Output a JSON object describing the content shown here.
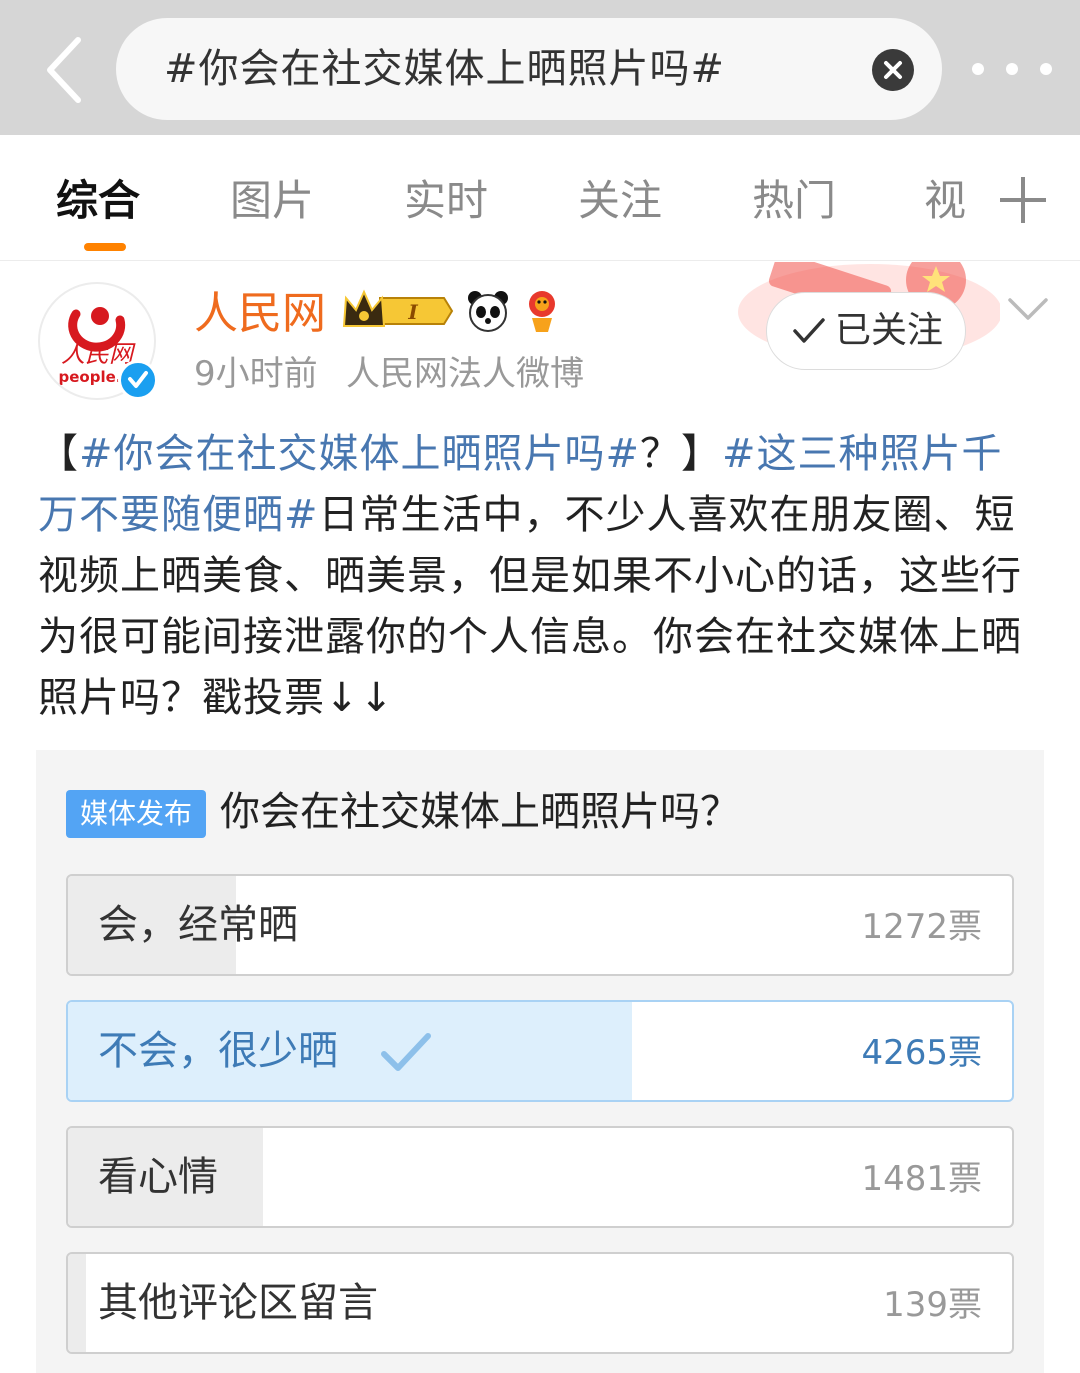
{
  "search": {
    "query": "#你会在社交媒体上晒照片吗#"
  },
  "tabs": [
    {
      "label": "综合",
      "active": true
    },
    {
      "label": "图片"
    },
    {
      "label": "实时"
    },
    {
      "label": "关注"
    },
    {
      "label": "热门"
    },
    {
      "label": "视"
    }
  ],
  "post": {
    "avatar_text": "人民网",
    "avatar_subtext": "people.",
    "user_name": "人民网",
    "time": "9小时前",
    "source": "人民网法人微博",
    "follow_label": "已关注",
    "body": [
      {
        "type": "text",
        "text": "【"
      },
      {
        "type": "topic",
        "text": "#你会在社交媒体上晒照片吗#"
      },
      {
        "type": "text",
        "text": "？】"
      },
      {
        "type": "topic",
        "text": "#这三种照片千万不要随便晒#"
      },
      {
        "type": "text",
        "text": "日常生活中，不少人喜欢在朋友圈、短视频上晒美食、晒美景，但是如果不小心的话，这些行为很可能间接泄露你的个人信息。你会在社交媒体上晒照片吗？戳投票↓↓"
      }
    ]
  },
  "vote": {
    "tag": "媒体发布",
    "question": "你会在社交媒体上晒照片吗？",
    "options": [
      {
        "label": "会，经常晒",
        "count_label": "1272票",
        "votes": 1272,
        "share": 0.178,
        "selected": false
      },
      {
        "label": "不会，很少晒",
        "count_label": "4265票",
        "votes": 4265,
        "share": 0.597,
        "selected": true
      },
      {
        "label": "看心情",
        "count_label": "1481票",
        "votes": 1481,
        "share": 0.207,
        "selected": false
      },
      {
        "label": "其他评论区留言",
        "count_label": "139票",
        "votes": 139,
        "share": 0.019,
        "selected": false
      }
    ]
  },
  "colors": {
    "accent_orange": "#ff8200",
    "username_orange": "#ef6b1e",
    "topic_blue": "#4877b0",
    "vote_selected_fill": "#ddeffc",
    "vote_tag_blue": "#53a4f4"
  },
  "icons": [
    "back-arrow-icon",
    "clear-icon",
    "more-dots-icon",
    "add-tab-icon",
    "verified-icon",
    "crown-level-icon",
    "panda-icon",
    "lion-icon",
    "checkmark-icon",
    "chevron-down-icon"
  ]
}
